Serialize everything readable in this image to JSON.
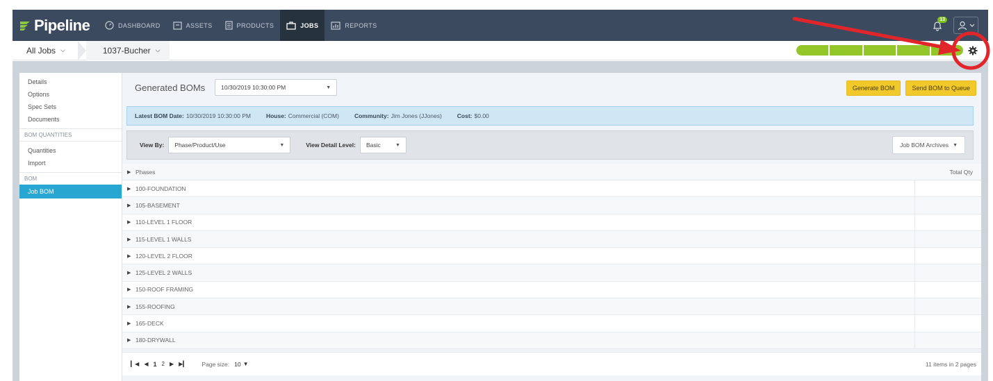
{
  "brand": {
    "name": "Pipeline"
  },
  "nav": {
    "items": [
      {
        "label": "DASHBOARD",
        "icon": "dashboard-icon"
      },
      {
        "label": "ASSETS",
        "icon": "assets-icon"
      },
      {
        "label": "PRODUCTS",
        "icon": "products-icon"
      },
      {
        "label": "JOBS",
        "icon": "jobs-icon",
        "active": true
      },
      {
        "label": "REPORTS",
        "icon": "reports-icon"
      }
    ],
    "notification_count": "13"
  },
  "breadcrumb": {
    "first": "All Jobs",
    "second": "1037-Bucher"
  },
  "progress": {
    "segments": 5,
    "filled_fraction": 1.0,
    "color": "#92c629"
  },
  "sidebar": {
    "top_links": [
      "Details",
      "Options",
      "Spec Sets",
      "Documents"
    ],
    "section1_title": "BOM QUANTITIES",
    "section1_links": [
      "Quantities",
      "Import"
    ],
    "section2_title": "BOM",
    "section2_active": "Job BOM"
  },
  "generated": {
    "title": "Generated BOMs",
    "selected_date": "10/30/2019 10:30:00 PM",
    "generate_btn": "Generate BOM",
    "queue_btn": "Send BOM to Queue"
  },
  "info": {
    "latest_label": "Latest BOM Date:",
    "latest_value": "10/30/2019 10:30:00 PM",
    "house_label": "House:",
    "house_value": "Commercial (COM)",
    "community_label": "Community:",
    "community_value": "Jim Jones (JJones)",
    "cost_label": "Cost:",
    "cost_value": "$0.00"
  },
  "filters": {
    "view_by_label": "View By:",
    "view_by_value": "Phase/Product/Use",
    "detail_label": "View Detail Level:",
    "detail_value": "Basic",
    "archives_label": "Job BOM Archives"
  },
  "grid": {
    "col_phases": "Phases",
    "col_total": "Total Qty",
    "rows": [
      "100-FOUNDATION",
      "105-BASEMENT",
      "110-LEVEL 1 FLOOR",
      "115-LEVEL 1 WALLS",
      "120-LEVEL 2 FLOOR",
      "125-LEVEL 2 WALLS",
      "150-ROOF FRAMING",
      "155-ROOFING",
      "165-DECK",
      "180-DRYWALL"
    ]
  },
  "pager": {
    "page1": "1",
    "page2": "2",
    "size_label": "Page size:",
    "size_value": "10",
    "summary": "11 items in 2 pages"
  },
  "colors": {
    "nav_bg": "#3b4a5f",
    "accent_blue": "#27a6d1",
    "button_yellow": "#f2c92b",
    "annotation_red": "#e0262b"
  }
}
